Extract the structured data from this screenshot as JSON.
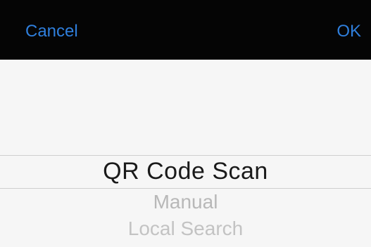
{
  "topbar": {
    "cancel_label": "Cancel",
    "ok_label": "OK",
    "accent_color": "#2f7fdc",
    "background_color": "#050505"
  },
  "picker": {
    "selected": "QR Code Scan",
    "options": [
      {
        "label": "QR Code Scan"
      },
      {
        "label": "Manual"
      },
      {
        "label": "Local Search"
      }
    ]
  }
}
